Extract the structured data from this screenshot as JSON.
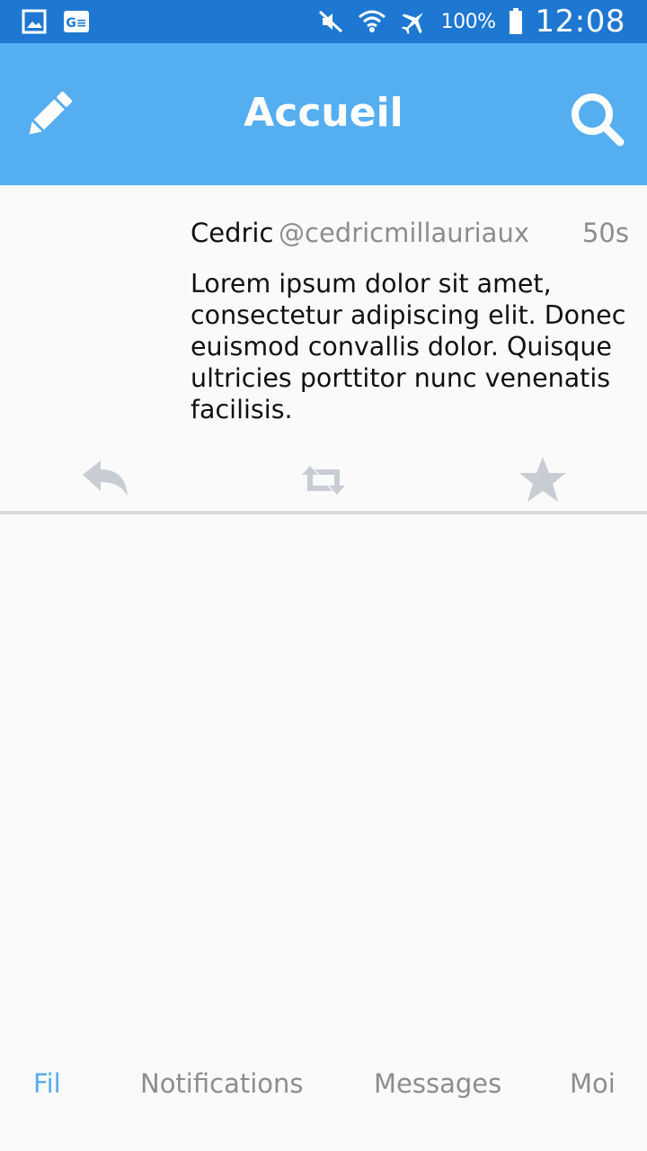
{
  "status_bar": {
    "icons": [
      "gallery-icon",
      "ge-icon",
      "mute-icon",
      "wifi-icon",
      "airplane-icon",
      "battery-icon"
    ],
    "battery_percent": "100%",
    "time": "12:08"
  },
  "app_bar": {
    "title": "Accueil",
    "left_icon": "pencil-icon",
    "right_icon": "search-icon",
    "color": "#55aef0"
  },
  "feed": {
    "tweets": [
      {
        "name": "Cedric",
        "handle": "@cedricmillauriaux",
        "time": "50s",
        "text": "Lorem ipsum dolor sit amet, consectetur adipiscing elit. Donec euismod convallis dolor. Quisque ultricies porttitor nunc venenatis facilisis.",
        "actions": [
          "reply-icon",
          "retweet-icon",
          "star-icon"
        ]
      }
    ]
  },
  "tabs": {
    "items": [
      "Fil",
      "Notifications",
      "Messages",
      "Moi"
    ],
    "active": "Fil",
    "active_color": "#55aef0",
    "inactive_color": "#8d8d8d"
  }
}
